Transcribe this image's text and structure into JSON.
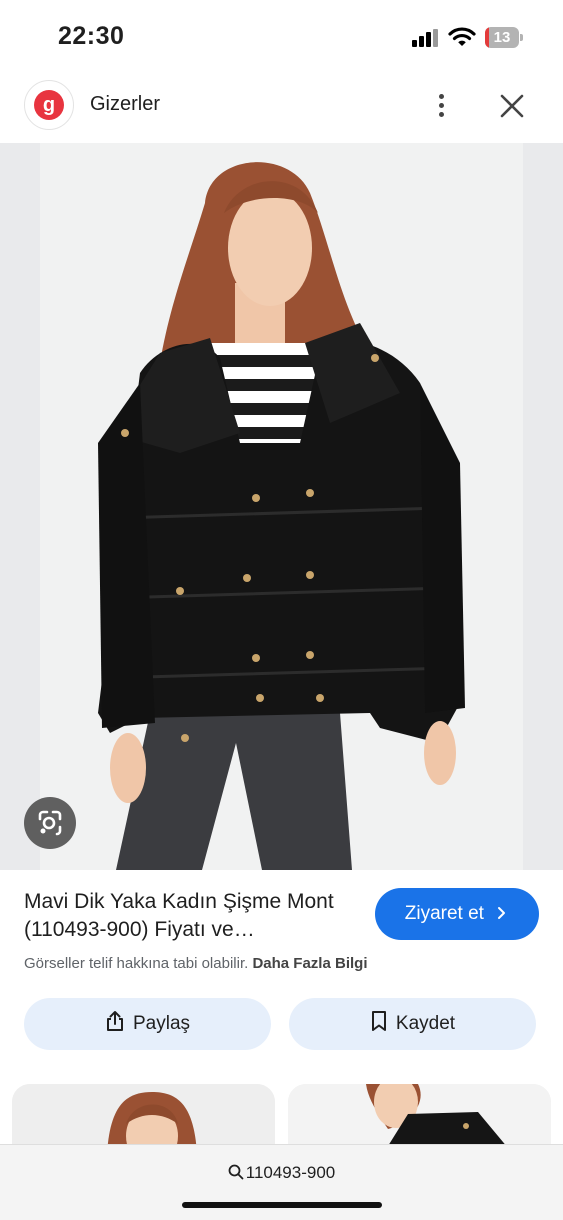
{
  "status_bar": {
    "time": "22:30",
    "battery": "13"
  },
  "header": {
    "site_name": "Gizerler",
    "logo_letter": "g"
  },
  "result": {
    "title": "Mavi Dik Yaka Kadın Şişme Mont (110493-900) Fiyatı ve…",
    "visit_label": "Ziyaret et",
    "copyright_text": "Görseller telif hakkına tabi olabilir.",
    "more_info_label": "Daha Fazla Bilgi"
  },
  "actions": {
    "share_label": "Paylaş",
    "save_label": "Kaydet"
  },
  "search": {
    "query": "110493-900"
  },
  "colors": {
    "accent": "#1a73e8",
    "logo_red": "#e8343f",
    "button_bg": "#e6effb"
  },
  "icons": [
    "signal-icon",
    "wifi-icon",
    "battery-icon",
    "more-vert-icon",
    "close-icon",
    "lens-icon",
    "chevron-right-icon",
    "share-icon",
    "bookmark-icon",
    "search-icon"
  ]
}
